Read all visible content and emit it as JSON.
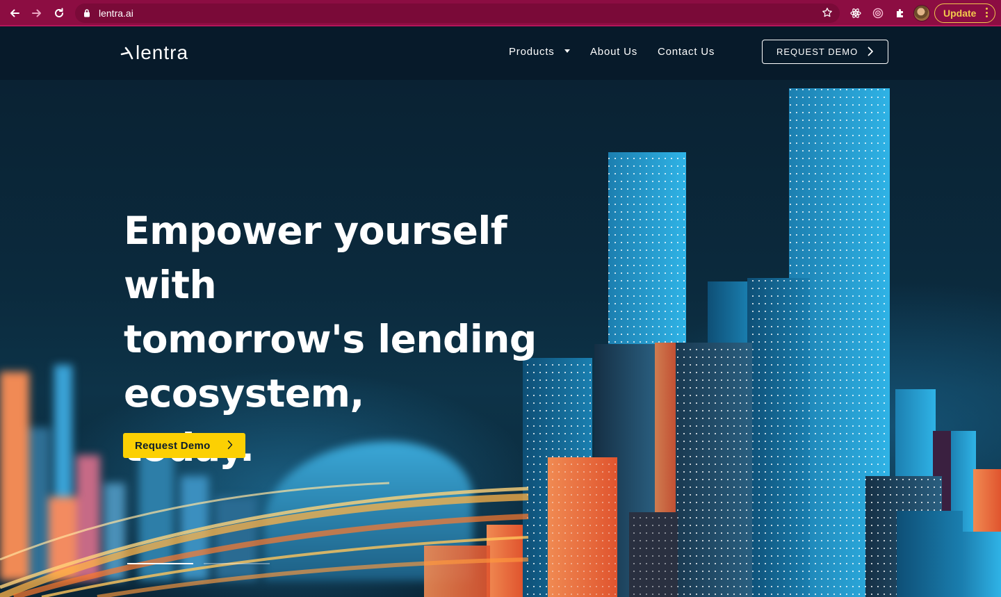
{
  "browser": {
    "url": "lentra.ai",
    "update_label": "Update",
    "theme_color": "#8c0d42",
    "icons": [
      "back-arrow-icon",
      "forward-arrow-icon",
      "reload-icon",
      "lock-icon",
      "bookmark-star-icon",
      "react-devtools-icon",
      "screen-recorder-icon",
      "extensions-puzzle-icon",
      "profile-avatar",
      "more-vert-icon"
    ]
  },
  "header": {
    "logo_text": "lentra",
    "nav": {
      "products": "Products",
      "about": "About Us",
      "contact": "Contact Us"
    },
    "request_demo": "REQUEST DEMO"
  },
  "hero": {
    "title_lines": [
      "Empower yourself with",
      "tomorrow's lending",
      "ecosystem,",
      "today."
    ],
    "cta_label": "Request Demo",
    "cta_color": "#fcd003",
    "slides": {
      "count": 2,
      "active": 0
    }
  }
}
